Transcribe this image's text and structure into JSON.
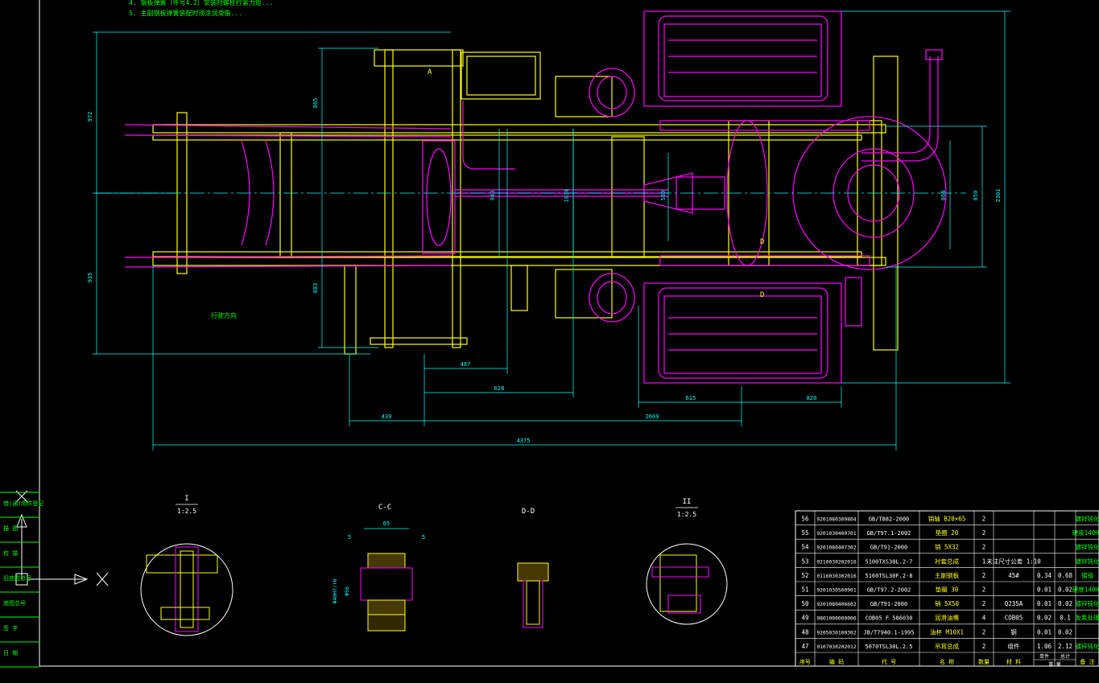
{
  "notes": {
    "line4": "4. 钢板弹簧（件号4.2）安装时螺栓拧紧力矩...",
    "line5": "5. 主副钢板弹簧装配时须涂润滑脂..."
  },
  "labels": {
    "section_a": "A",
    "section_d1": "D",
    "section_d2": "D",
    "travel_dir": "行驶方向"
  },
  "dimensions": {
    "d_4375": "4375",
    "d_2669": "2669",
    "d_439": "439",
    "d_628": "628",
    "d_487": "487",
    "d_615": "615",
    "d_820": "820",
    "d_972": "972",
    "d_935": "935",
    "d_865": "865",
    "d_883": "883",
    "d_943": "943",
    "d_1038": "1038",
    "d_580": "580",
    "d_864": "864",
    "d_850": "850",
    "d_2301": "2301"
  },
  "details": {
    "I_title": "I",
    "I_scale": "1:2.5",
    "CC_title": "C-C",
    "CC_dim_top": "65",
    "CC_dim_5a": "5",
    "CC_dim_5b": "5",
    "CC_dim_left1": "Φ40H7/r6",
    "CC_dim_left2": "Φ56",
    "DD_title": "D-D",
    "II_title": "II",
    "II_scale": "1:2.5"
  },
  "axis": {
    "x_label": "X"
  },
  "side_panel": {
    "cells": [
      "借(通)用件登记",
      "描 图",
      "校 描",
      "旧底图总号",
      "底图总号",
      "签 字",
      "日 期"
    ]
  },
  "bom": {
    "rows": [
      {
        "no": "56",
        "code": "9201080309804",
        "std": "GB/T882-2000",
        "name": "销轴 B20×65",
        "qty": "2",
        "mat": "",
        "w1": "",
        "w2": "",
        "note": "镀锌钝化"
      },
      {
        "no": "55",
        "code": "9201030400701",
        "std": "GB/T97.1-2002",
        "name": "垫圈 20",
        "qty": "2",
        "mat": "",
        "w1": "",
        "w2": "",
        "note": "硬度140HV"
      },
      {
        "no": "54",
        "code": "9201080407302",
        "std": "GB/T91-2000",
        "name": "销 5X32",
        "qty": "2",
        "mat": "",
        "w1": "",
        "w2": "",
        "note": "镀锌钝化"
      },
      {
        "no": "53",
        "code": "0210030202016",
        "std": "5100TXS30L.2-7",
        "name": "衬套总成",
        "qty": "1",
        "mat": "未注尺寸公差 1:10",
        "w1": "",
        "w2": "",
        "note": "镀锌钝化"
      },
      {
        "no": "52",
        "code": "0116030302016",
        "std": "5160TSL30F.2-8",
        "name": "主副钢板",
        "qty": "2",
        "mat": "45#",
        "w1": "0.34",
        "w2": "0.68",
        "note": "镀铬"
      },
      {
        "no": "51",
        "code": "9201030500901",
        "std": "GB/T97.2-2002",
        "name": "垫圈 30",
        "qty": "2",
        "mat": "",
        "w1": "0.01",
        "w2": "0.02",
        "note": "硬度140HV"
      },
      {
        "no": "50",
        "code": "9201080406602",
        "std": "GB/T91-2000",
        "name": "销 5X50",
        "qty": "2",
        "mat": "Q235A",
        "w1": "0.01",
        "w2": "0.02",
        "note": "镀锌钝化"
      },
      {
        "no": "49",
        "code": "9801000000006",
        "std": "COB05 F 586030",
        "name": "润滑油嘴",
        "qty": "4",
        "mat": "COB05",
        "w1": "0.02",
        "w2": "0.1",
        "note": "发黑处理"
      },
      {
        "no": "48",
        "code": "9205030100302",
        "std": "JB/T7940.1-1995",
        "name": "油杯 M10X1",
        "qty": "2",
        "mat": "钢",
        "w1": "0.01",
        "w2": "0.02",
        "note": ""
      },
      {
        "no": "47",
        "code": "0107030202012",
        "std": "5070TSL30L.2.5",
        "name": "吊耳总成",
        "qty": "2",
        "mat": "组件",
        "w1": "1.06",
        "w2": "2.12",
        "note": "镀锌钝化"
      }
    ],
    "header": {
      "no": "序号",
      "code": "编 码",
      "std": "代 号",
      "name": "名 称",
      "qty": "数量",
      "mat": "材 料",
      "w1": "单件",
      "w2": "总计",
      "weight": "重 量",
      "note": "备 注"
    }
  },
  "colors": {
    "background": "#000000",
    "frame": "#ffffff",
    "yellow": "#ffff00",
    "magenta": "#ff00ff",
    "cyan": "#00ffff",
    "green": "#00ff00",
    "white": "#ffffff",
    "red": "#ff0000"
  }
}
